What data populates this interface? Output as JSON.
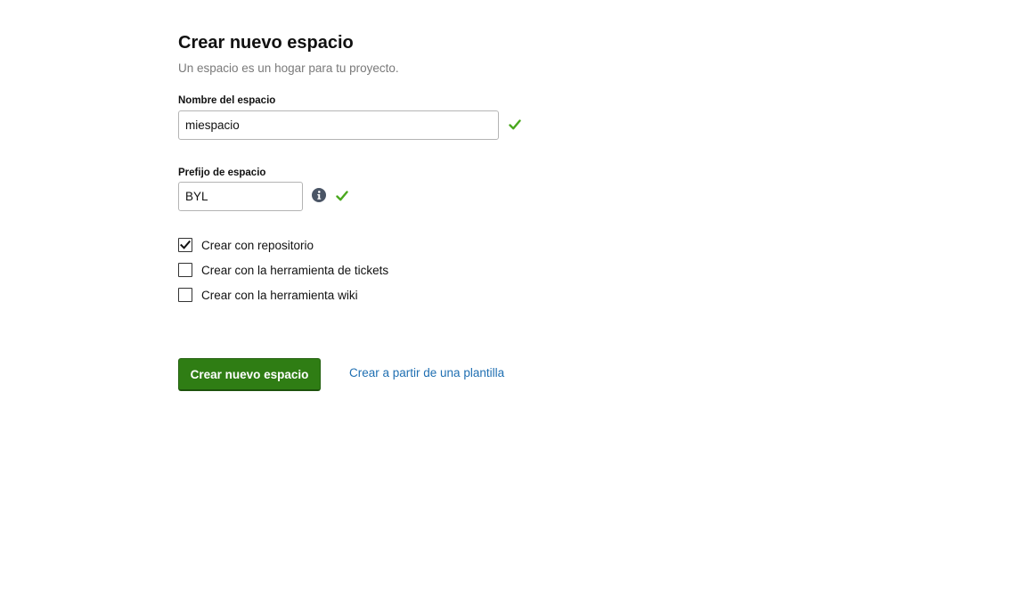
{
  "form": {
    "title": "Crear nuevo espacio",
    "subtitle": "Un espacio es un hogar para tu proyecto.",
    "space_name": {
      "label": "Nombre del espacio",
      "value": "miespacio",
      "status_icon": "check-icon",
      "valid": true
    },
    "space_prefix": {
      "label": "Prefijo de espacio",
      "value": "BYL",
      "info_icon": "info-icon",
      "status_icon": "check-icon",
      "valid": true
    },
    "options": [
      {
        "label": "Crear con repositorio",
        "checked": true
      },
      {
        "label": "Crear con la herramienta de tickets",
        "checked": false
      },
      {
        "label": "Crear con la herramienta wiki",
        "checked": false
      }
    ],
    "submit_label": "Crear nuevo espacio",
    "template_link_label": "Crear a partir de una plantilla"
  },
  "colors": {
    "primary_button": "#2f7d14",
    "link": "#1f6fb2",
    "valid_check": "#4aa81e",
    "info_icon": "#4a5565",
    "subtitle": "#7a7a7a"
  }
}
